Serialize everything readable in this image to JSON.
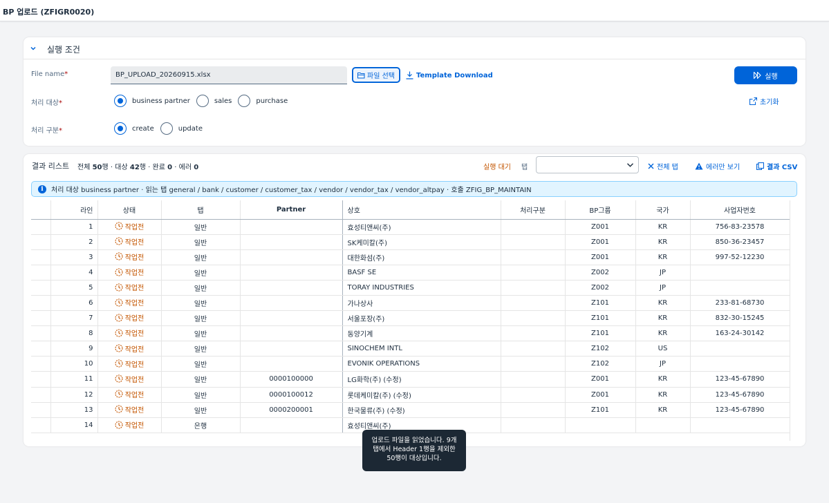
{
  "shell": {
    "title": "BP 업로드 (ZFIGR0020)"
  },
  "criteria": {
    "title": "실행 조건",
    "file_label": "File name",
    "file_value": "BP_UPLOAD_20260915.xlsx",
    "select_file_label": "파일 선택",
    "template_label": "Template Download",
    "run_label": "실행",
    "reset_label": "초기화",
    "target_label": "처리 대상",
    "target_options": [
      "business partner",
      "sales",
      "purchase"
    ],
    "target_selected": "business partner",
    "mode_label": "처리 구분",
    "mode_options": [
      "create",
      "update"
    ],
    "mode_selected": "create",
    "required_mark": "*"
  },
  "results": {
    "title": "결과 리스트",
    "summary": {
      "total_label": "전체",
      "total": "50",
      "total_unit": "행",
      "target_label": "대상",
      "target": "42",
      "target_unit": "행",
      "done_label": "완료",
      "done": "0",
      "error_label": "에러",
      "error": "0"
    },
    "run_state": "실행 대기",
    "tab_label": "탭",
    "tab_select_value": "",
    "btn_all_tabs": "전체 탭",
    "btn_errors_only": "에러만 보기",
    "btn_csv": "결과 CSV",
    "info": "처리 대상 business partner · 읽는 탭 general / bank / customer / customer_tax / vendor / vendor_tax / vendor_altpay · 호출 ZFIG_BP_MAINTAIN",
    "columns": [
      "라인",
      "상태",
      "탭",
      "Partner",
      "상호",
      "처리구분",
      "BP그룹",
      "국가",
      "사업자번호"
    ],
    "rows": [
      {
        "line": "1",
        "status": "작업전",
        "tab": "일반",
        "partner": "",
        "name": "효성티앤씨(주)",
        "mode": "",
        "group": "Z001",
        "country": "KR",
        "bizno": "756-83-23578"
      },
      {
        "line": "2",
        "status": "작업전",
        "tab": "일반",
        "partner": "",
        "name": "SK케미칼(주)",
        "mode": "",
        "group": "Z001",
        "country": "KR",
        "bizno": "850-36-23457"
      },
      {
        "line": "3",
        "status": "작업전",
        "tab": "일반",
        "partner": "",
        "name": "대한화섬(주)",
        "mode": "",
        "group": "Z001",
        "country": "KR",
        "bizno": "997-52-12230"
      },
      {
        "line": "4",
        "status": "작업전",
        "tab": "일반",
        "partner": "",
        "name": "BASF SE",
        "mode": "",
        "group": "Z002",
        "country": "JP",
        "bizno": ""
      },
      {
        "line": "5",
        "status": "작업전",
        "tab": "일반",
        "partner": "",
        "name": "TORAY INDUSTRIES",
        "mode": "",
        "group": "Z002",
        "country": "JP",
        "bizno": ""
      },
      {
        "line": "6",
        "status": "작업전",
        "tab": "일반",
        "partner": "",
        "name": "가나상사",
        "mode": "",
        "group": "Z101",
        "country": "KR",
        "bizno": "233-81-68730"
      },
      {
        "line": "7",
        "status": "작업전",
        "tab": "일반",
        "partner": "",
        "name": "서울포장(주)",
        "mode": "",
        "group": "Z101",
        "country": "KR",
        "bizno": "832-30-15245"
      },
      {
        "line": "8",
        "status": "작업전",
        "tab": "일반",
        "partner": "",
        "name": "동양기계",
        "mode": "",
        "group": "Z101",
        "country": "KR",
        "bizno": "163-24-30142"
      },
      {
        "line": "9",
        "status": "작업전",
        "tab": "일반",
        "partner": "",
        "name": "SINOCHEM INTL",
        "mode": "",
        "group": "Z102",
        "country": "US",
        "bizno": ""
      },
      {
        "line": "10",
        "status": "작업전",
        "tab": "일반",
        "partner": "",
        "name": "EVONIK OPERATIONS",
        "mode": "",
        "group": "Z102",
        "country": "JP",
        "bizno": ""
      },
      {
        "line": "11",
        "status": "작업전",
        "tab": "일반",
        "partner": "0000100000",
        "name": "LG화학(주) (수정)",
        "mode": "",
        "group": "Z001",
        "country": "KR",
        "bizno": "123-45-67890"
      },
      {
        "line": "12",
        "status": "작업전",
        "tab": "일반",
        "partner": "0000100012",
        "name": "롯데케미칼(주) (수정)",
        "mode": "",
        "group": "Z001",
        "country": "KR",
        "bizno": "123-45-67890"
      },
      {
        "line": "13",
        "status": "작업전",
        "tab": "일반",
        "partner": "0000200001",
        "name": "한국물류(주) (수정)",
        "mode": "",
        "group": "Z101",
        "country": "KR",
        "bizno": "123-45-67890"
      },
      {
        "line": "14",
        "status": "작업전",
        "tab": "은행",
        "partner": "",
        "name": "효성티앤씨(주)",
        "mode": "",
        "group": "",
        "country": "",
        "bizno": ""
      }
    ]
  },
  "toast": {
    "message": "업로드 파일을 읽었습니다. 9개 탭에서 Header 1행을 제외한 50행이 대상입니다."
  },
  "colors": {
    "accent": "#0064d9",
    "status": "#c35500",
    "info_bg": "#e1f4ff"
  }
}
